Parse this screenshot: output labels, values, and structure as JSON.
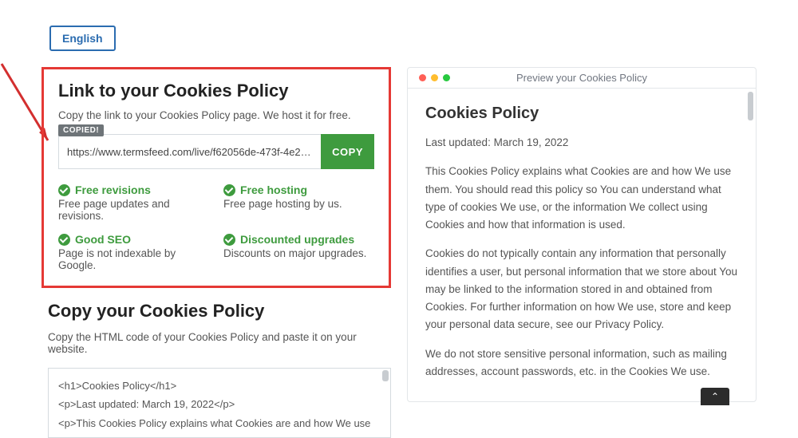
{
  "lang_button": "English",
  "link_section": {
    "title": "Link to your Cookies Policy",
    "desc": "Copy the link to your Cookies Policy page. We host it for free.",
    "copied_badge": "COPIED!",
    "url": "https://www.termsfeed.com/live/f62056de-473f-4e26-af8c-38…",
    "copy_btn": "COPY",
    "features": [
      {
        "title": "Free revisions",
        "desc": "Free page updates and revisions."
      },
      {
        "title": "Free hosting",
        "desc": "Free page hosting by us."
      },
      {
        "title": "Good SEO",
        "desc": "Page is not indexable by Google."
      },
      {
        "title": "Discounted upgrades",
        "desc": "Discounts on major upgrades."
      }
    ]
  },
  "copy_section": {
    "title": "Copy your Cookies Policy",
    "desc": "Copy the HTML code of your Cookies Policy and paste it on your website.",
    "html_lines": [
      "<h1>Cookies Policy</h1>",
      "<p>Last updated: March 19, 2022</p>",
      "<p>This Cookies Policy explains what Cookies are and how We use"
    ]
  },
  "preview": {
    "header": "Preview your Cookies Policy",
    "heading": "Cookies Policy",
    "updated": "Last updated: March 19, 2022",
    "p1": "This Cookies Policy explains what Cookies are and how We use them. You should read this policy so You can understand what type of cookies We use, or the information We collect using Cookies and how that information is used.",
    "p2": "Cookies do not typically contain any information that personally identifies a user, but personal information that we store about You may be linked to the information stored in and obtained from Cookies. For further information on how We use, store and keep your personal data secure, see our Privacy Policy.",
    "p3": "We do not store sensitive personal information, such as mailing addresses, account passwords, etc. in the Cookies We use."
  }
}
